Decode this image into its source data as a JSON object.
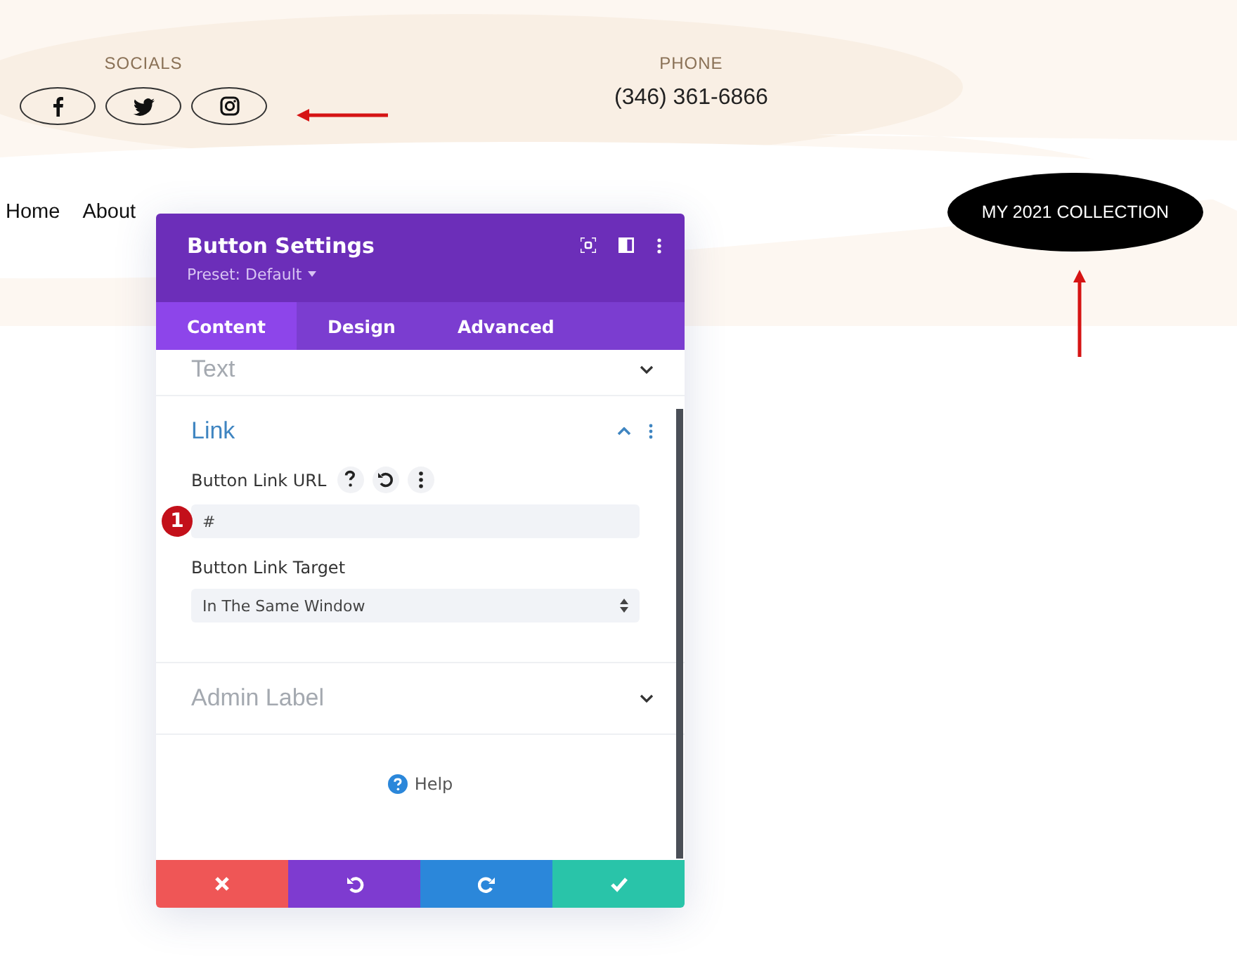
{
  "header": {
    "socials": {
      "label": "SOCIALS",
      "buttons": [
        {
          "kind": "facebook"
        },
        {
          "kind": "twitter"
        },
        {
          "kind": "instagram"
        }
      ]
    },
    "phone": {
      "label": "PHONE",
      "number": "(346) 361-6866"
    },
    "nav": [
      "Home",
      "About"
    ],
    "cta": "MY 2021 COLLECTION"
  },
  "modal": {
    "title": "Button Settings",
    "preset": "Preset: Default",
    "tabs": [
      {
        "label": "Content",
        "selected": true
      },
      {
        "label": "Design",
        "selected": false
      },
      {
        "label": "Advanced",
        "selected": false
      }
    ],
    "sections": [
      {
        "title": "Text",
        "expanded": false
      },
      {
        "title": "Link",
        "expanded": true,
        "fields": [
          {
            "kind": "text",
            "label": "Button Link URL",
            "value": "#",
            "marker": "1"
          },
          {
            "kind": "select",
            "label": "Button Link Target",
            "value": "In The Same Window"
          }
        ]
      },
      {
        "title": "Admin Label",
        "expanded": false
      }
    ],
    "help": "Help",
    "actions": [
      {
        "kind": "cancel"
      },
      {
        "kind": "undo"
      },
      {
        "kind": "redo"
      },
      {
        "kind": "save"
      }
    ]
  }
}
